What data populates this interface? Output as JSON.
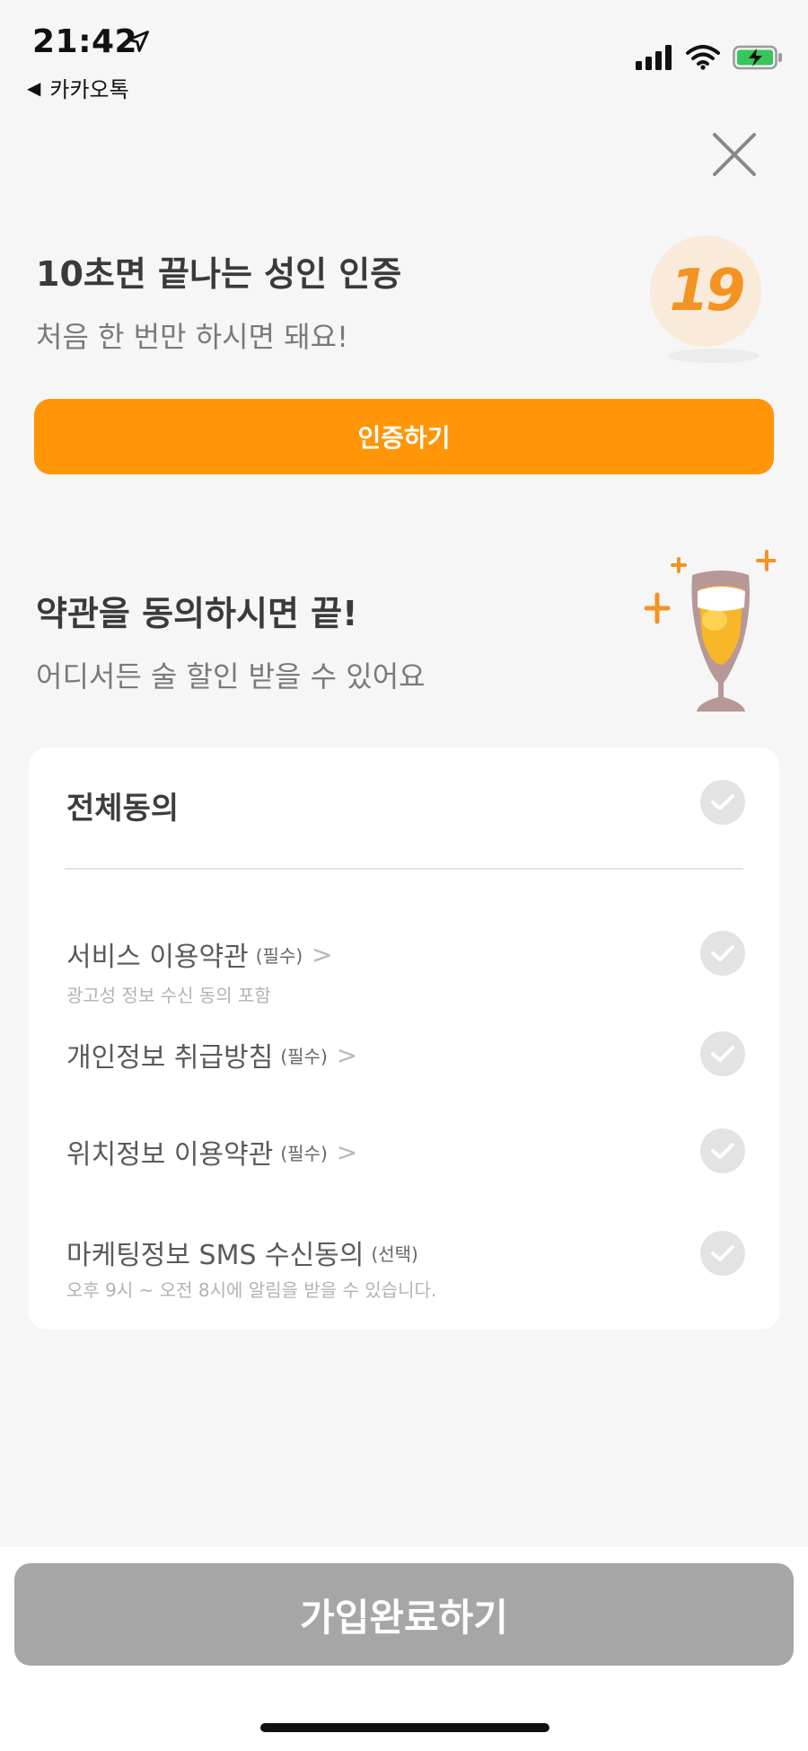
{
  "status": {
    "time": "21:42",
    "back_app": "카카오톡"
  },
  "verify": {
    "title": "10초면 끝나는 성인 인증",
    "subtitle": "처음 한 번만 하시면 돼요!",
    "badge": "19",
    "button_label": "인증하기"
  },
  "terms": {
    "title": "약관을 동의하시면 끝!",
    "subtitle": "어디서든 술 할인 받을 수 있어요",
    "agree_all_label": "전체동의",
    "items": [
      {
        "label": "서비스 이용약관",
        "tag": "(필수)",
        "chevron": ">",
        "note": "광고성 정보 수신 동의 포함"
      },
      {
        "label": "개인정보 취급방침",
        "tag": "(필수)",
        "chevron": ">",
        "note": ""
      },
      {
        "label": "위치정보 이용약관",
        "tag": "(필수)",
        "chevron": ">",
        "note": ""
      },
      {
        "label": "마케팅정보 SMS 수신동의",
        "tag": "(선택)",
        "chevron": "",
        "note": "오후 9시 ~ 오전 8시에 알림을 받을 수 있습니다."
      }
    ]
  },
  "footer": {
    "submit_label": "가입완료하기"
  },
  "colors": {
    "accent": "#ff9507",
    "disabled_button": "#a6a6a6",
    "check_inactive": "#e3e3e3",
    "background": "#f6f6f6"
  },
  "icons": {
    "status": [
      "location-arrow-icon",
      "cellular-signal-icon",
      "wifi-icon",
      "battery-charging-icon"
    ],
    "close": "close-icon",
    "check": "checkmark-icon",
    "illustrations": [
      "adult-19-badge-icon",
      "beer-glass-icon"
    ]
  }
}
